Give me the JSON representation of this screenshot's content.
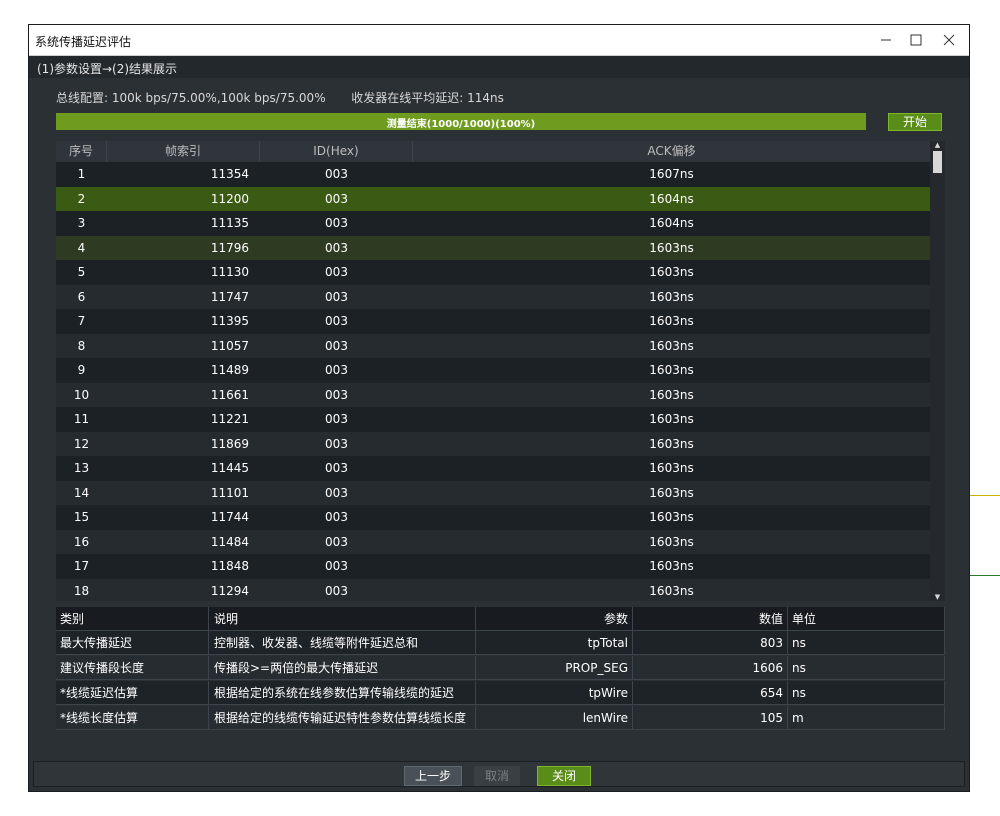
{
  "window": {
    "title": "系统传播延迟评估"
  },
  "breadcrumb": "(1)参数设置→(2)结果展示",
  "config": {
    "bus_label": "总线配置:",
    "bus_value": "100k bps/75.00%,100k bps/75.00%",
    "delay_label": "收发器在线平均延迟:",
    "delay_value": "114ns"
  },
  "progress": {
    "text": "测量结束(1000/1000)(100%)",
    "fraction": 1.0
  },
  "start_label": "开始",
  "grid": {
    "headers": [
      "序号",
      "帧索引",
      "ID(Hex)",
      "ACK偏移"
    ],
    "rows": [
      [
        "1",
        "11354",
        "003",
        "1607ns"
      ],
      [
        "2",
        "11200",
        "003",
        "1604ns"
      ],
      [
        "3",
        "11135",
        "003",
        "1604ns"
      ],
      [
        "4",
        "11796",
        "003",
        "1603ns"
      ],
      [
        "5",
        "11130",
        "003",
        "1603ns"
      ],
      [
        "6",
        "11747",
        "003",
        "1603ns"
      ],
      [
        "7",
        "11395",
        "003",
        "1603ns"
      ],
      [
        "8",
        "11057",
        "003",
        "1603ns"
      ],
      [
        "9",
        "11489",
        "003",
        "1603ns"
      ],
      [
        "10",
        "11661",
        "003",
        "1603ns"
      ],
      [
        "11",
        "11221",
        "003",
        "1603ns"
      ],
      [
        "12",
        "11869",
        "003",
        "1603ns"
      ],
      [
        "13",
        "11445",
        "003",
        "1603ns"
      ],
      [
        "14",
        "11101",
        "003",
        "1603ns"
      ],
      [
        "15",
        "11744",
        "003",
        "1603ns"
      ],
      [
        "16",
        "11484",
        "003",
        "1603ns"
      ],
      [
        "17",
        "11848",
        "003",
        "1603ns"
      ],
      [
        "18",
        "11294",
        "003",
        "1603ns"
      ]
    ],
    "selected_row": 2,
    "hover_row": 4
  },
  "info": {
    "headers": [
      "类别",
      "说明",
      "参数",
      "数值",
      "单位"
    ],
    "rows": [
      [
        "最大传播延迟",
        "控制器、收发器、线缆等附件延迟总和",
        "tpTotal",
        "803",
        "ns"
      ],
      [
        "建议传播段长度",
        "传播段>=两倍的最大传播延迟",
        "PROP_SEG",
        "1606",
        "ns"
      ],
      [
        "*线缆延迟估算",
        "根据给定的系统在线参数估算传输线缆的延迟",
        "tpWire",
        "654",
        "ns"
      ],
      [
        "*线缆长度估算",
        "根据给定的线缆传输延迟特性参数估算线缆长度",
        "lenWire",
        "105",
        "m"
      ]
    ]
  },
  "footer": {
    "prev": "上一步",
    "cancel": "取消",
    "close": "关闭"
  },
  "colors": {
    "accent": "#6f9b1f",
    "selected_row": "#3b5a14",
    "hover_row": "#2f3a22",
    "row_odd": "#1c2126",
    "row_even": "#262b30"
  }
}
